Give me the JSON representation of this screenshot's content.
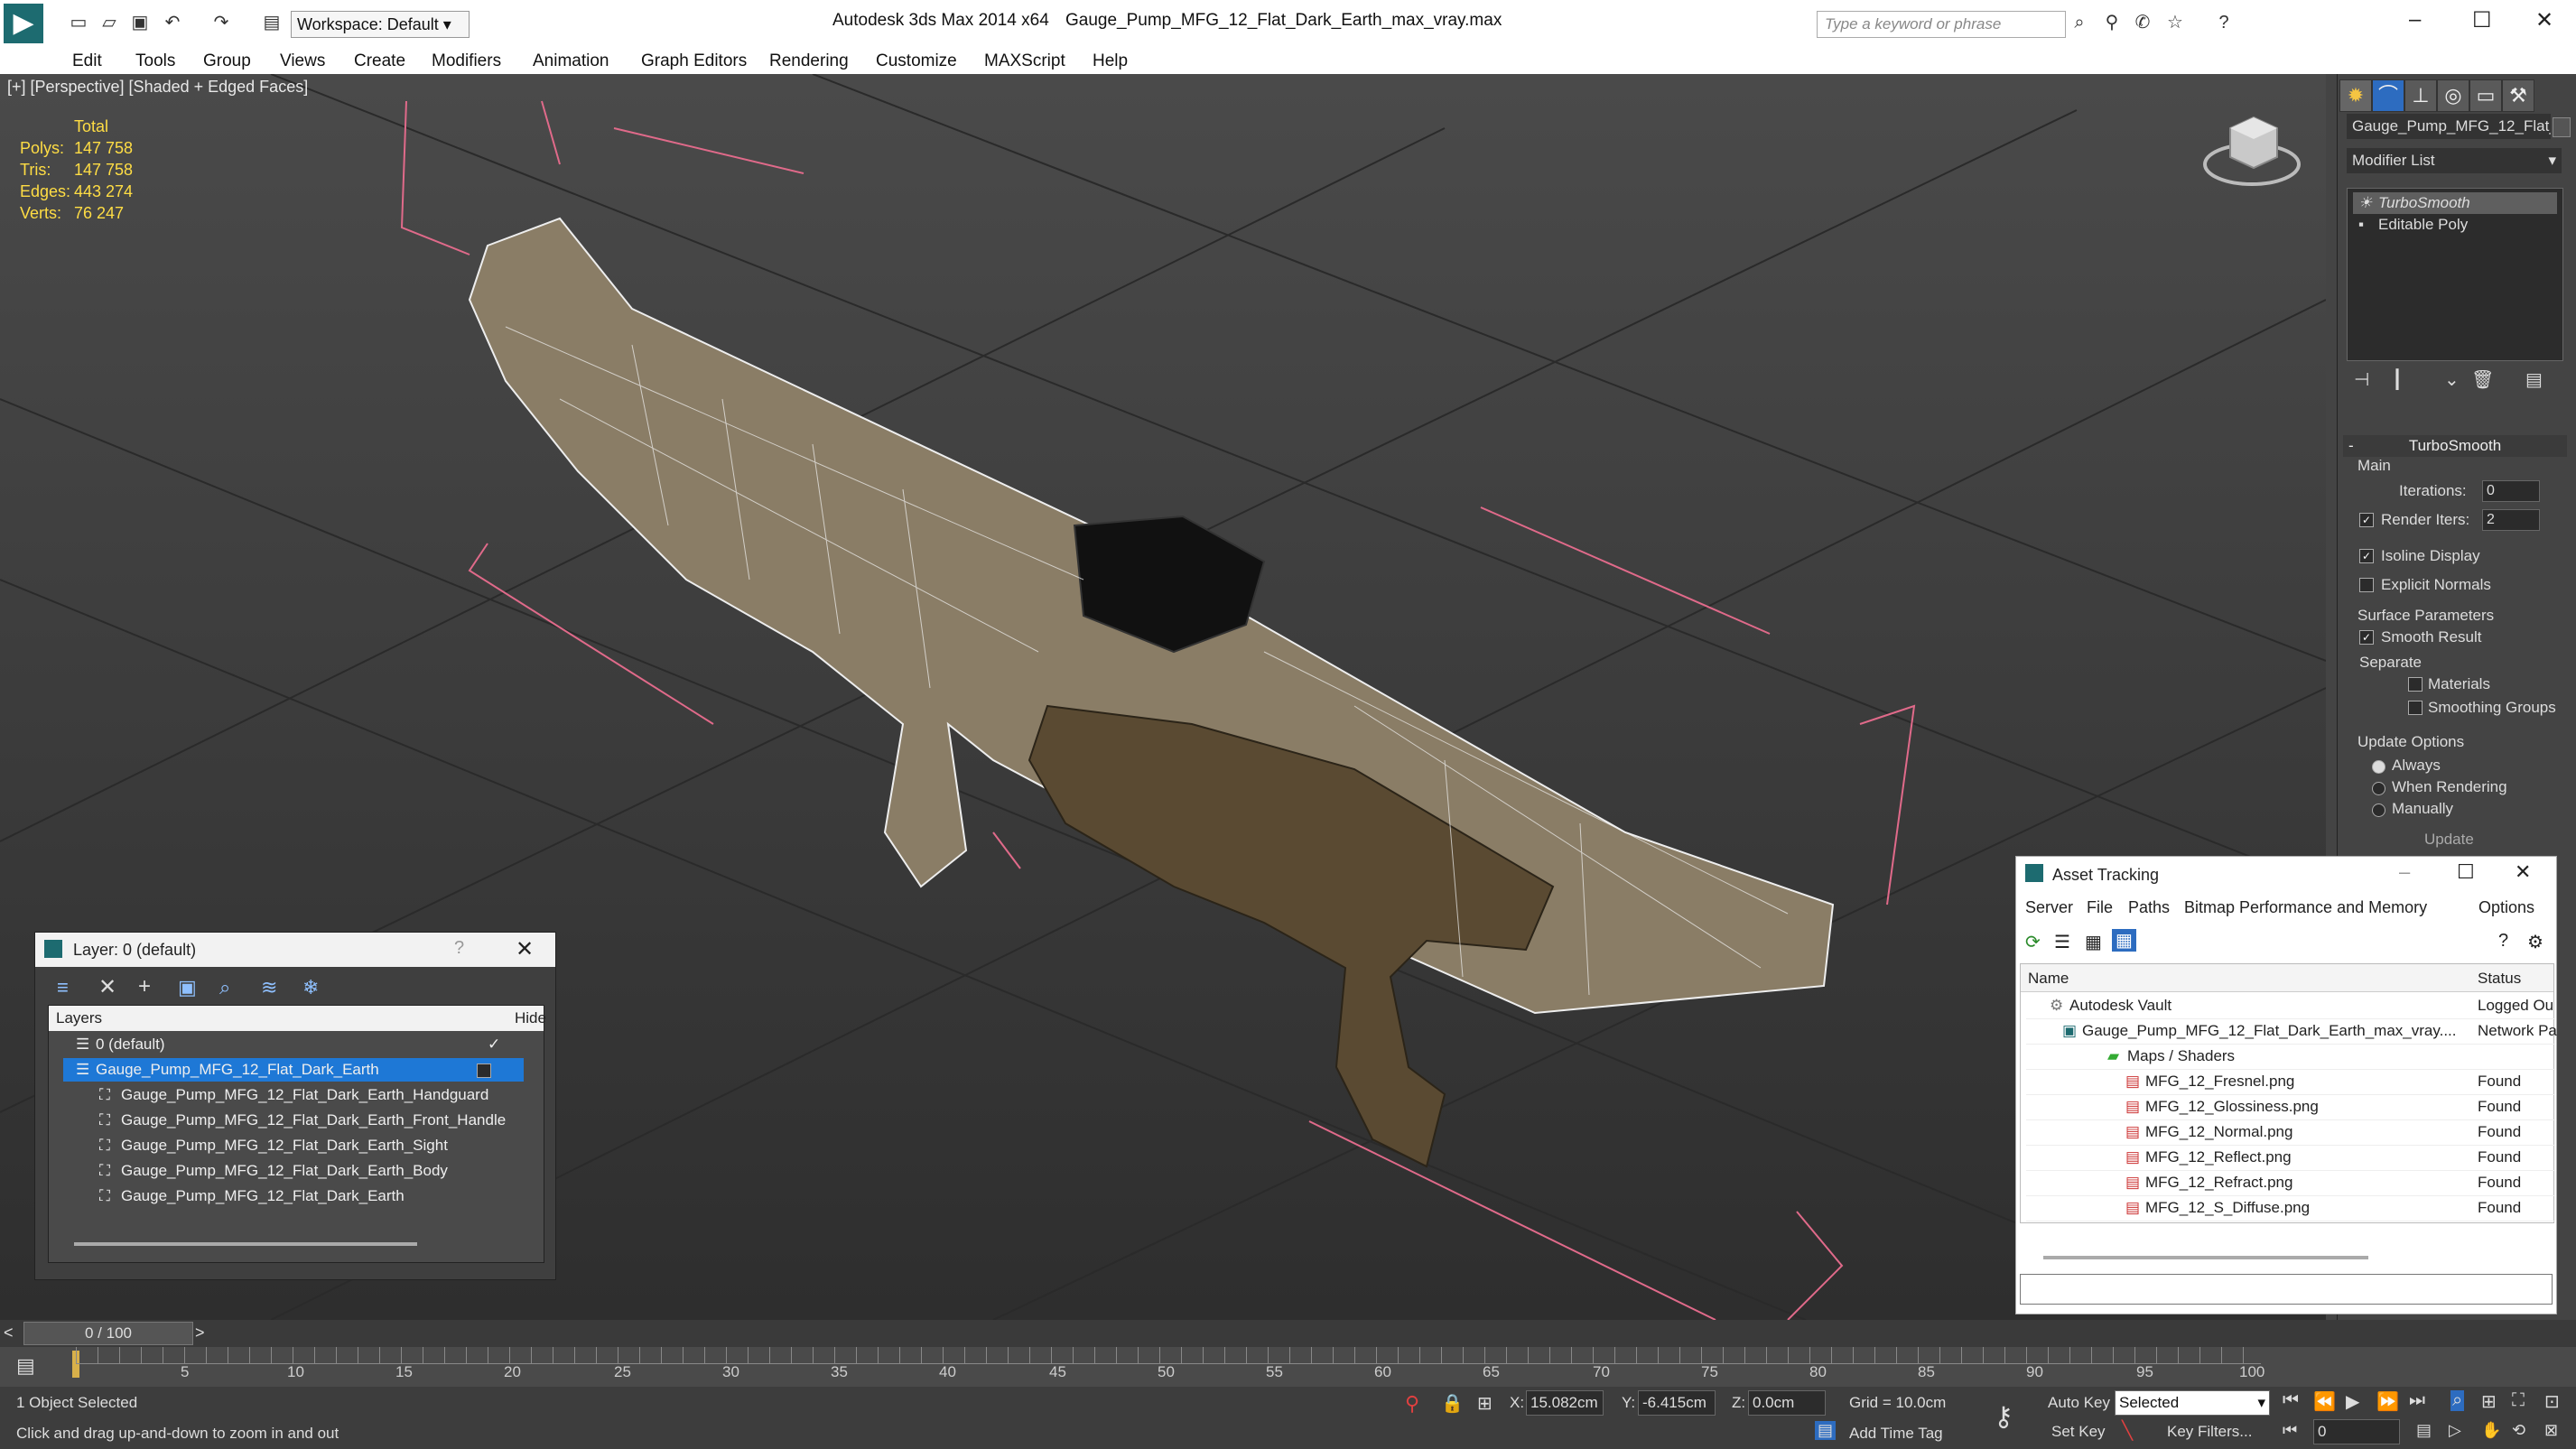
{
  "app": {
    "title": "Autodesk 3ds Max  2014 x64",
    "file": "Gauge_Pump_MFG_12_Flat_Dark_Earth_max_vray.max",
    "workspace": "Workspace: Default",
    "search_placeholder": "Type a keyword or phrase"
  },
  "menu": [
    "Edit",
    "Tools",
    "Group",
    "Views",
    "Create",
    "Modifiers",
    "Animation",
    "Graph Editors",
    "Rendering",
    "Customize",
    "MAXScript",
    "Help"
  ],
  "viewport": {
    "label": "[+] [Perspective] [Shaded + Edged Faces]",
    "stats": {
      "header": "Total",
      "rows": [
        {
          "label": "Polys:",
          "value": "147 758"
        },
        {
          "label": "Tris:",
          "value": "147 758"
        },
        {
          "label": "Edges:",
          "value": "443 274"
        },
        {
          "label": "Verts:",
          "value": "76 247"
        }
      ]
    }
  },
  "command_panel": {
    "object_name": "Gauge_Pump_MFG_12_Flat_I",
    "modifier_list": "Modifier List",
    "stack": [
      "TurboSmooth",
      "Editable Poly"
    ],
    "rollout_title": "TurboSmooth",
    "main": "Main",
    "iterations_label": "Iterations:",
    "iterations_value": "0",
    "render_iters_label": "Render Iters:",
    "render_iters_value": "2",
    "isoline_display": "Isoline Display",
    "explicit_normals": "Explicit Normals",
    "surface_parameters": "Surface Parameters",
    "smooth_result": "Smooth Result",
    "separate": "Separate",
    "materials": "Materials",
    "smoothing_groups": "Smoothing Groups",
    "update_options": "Update Options",
    "always": "Always",
    "when_rendering": "When Rendering",
    "manually": "Manually",
    "update_button": "Update"
  },
  "layer_dialog": {
    "title": "Layer: 0 (default)",
    "col_layers": "Layers",
    "col_hide": "Hide",
    "rows": [
      "0 (default)",
      "Gauge_Pump_MFG_12_Flat_Dark_Earth",
      "Gauge_Pump_MFG_12_Flat_Dark_Earth_Handguard",
      "Gauge_Pump_MFG_12_Flat_Dark_Earth_Front_Handle",
      "Gauge_Pump_MFG_12_Flat_Dark_Earth_Sight",
      "Gauge_Pump_MFG_12_Flat_Dark_Earth_Body",
      "Gauge_Pump_MFG_12_Flat_Dark_Earth"
    ]
  },
  "asset_tracking": {
    "title": "Asset Tracking",
    "menu": [
      "Server",
      "File",
      "Paths",
      "Bitmap Performance and Memory",
      "Options"
    ],
    "col_name": "Name",
    "col_status": "Status",
    "rows": [
      {
        "name": "Autodesk Vault",
        "status": "Logged Ou"
      },
      {
        "name": "Gauge_Pump_MFG_12_Flat_Dark_Earth_max_vray....",
        "status": "Network Pa"
      },
      {
        "name": "Maps / Shaders",
        "status": ""
      },
      {
        "name": "MFG_12_Fresnel.png",
        "status": "Found"
      },
      {
        "name": "MFG_12_Glossiness.png",
        "status": "Found"
      },
      {
        "name": "MFG_12_Normal.png",
        "status": "Found"
      },
      {
        "name": "MFG_12_Reflect.png",
        "status": "Found"
      },
      {
        "name": "MFG_12_Refract.png",
        "status": "Found"
      },
      {
        "name": "MFG_12_S_Diffuse.png",
        "status": "Found"
      }
    ]
  },
  "timeline": {
    "frame": "0 / 100",
    "ticks": [
      "5",
      "10",
      "15",
      "20",
      "25",
      "30",
      "35",
      "40",
      "45",
      "50",
      "55",
      "60",
      "65",
      "70",
      "75",
      "80",
      "85",
      "90",
      "95",
      "100"
    ]
  },
  "status": {
    "selected": "1 Object Selected",
    "hint": "Click and drag up-and-down to zoom in and out",
    "x_label": "X:",
    "x_value": "15.082cm",
    "y_label": "Y:",
    "y_value": "-6.415cm",
    "z_label": "Z:",
    "z_value": "0.0cm",
    "grid": "Grid = 10.0cm",
    "auto_key": "Auto Key",
    "set_key": "Set Key",
    "selected_dropdown": "Selected",
    "key_filters": "Key Filters...",
    "add_time_tag": "Add Time Tag",
    "frame_field": "0"
  },
  "colors": {
    "highlight": "#1e78d6",
    "stat_yellow": "#ffdd44",
    "model_tan": "#5a4a32"
  }
}
